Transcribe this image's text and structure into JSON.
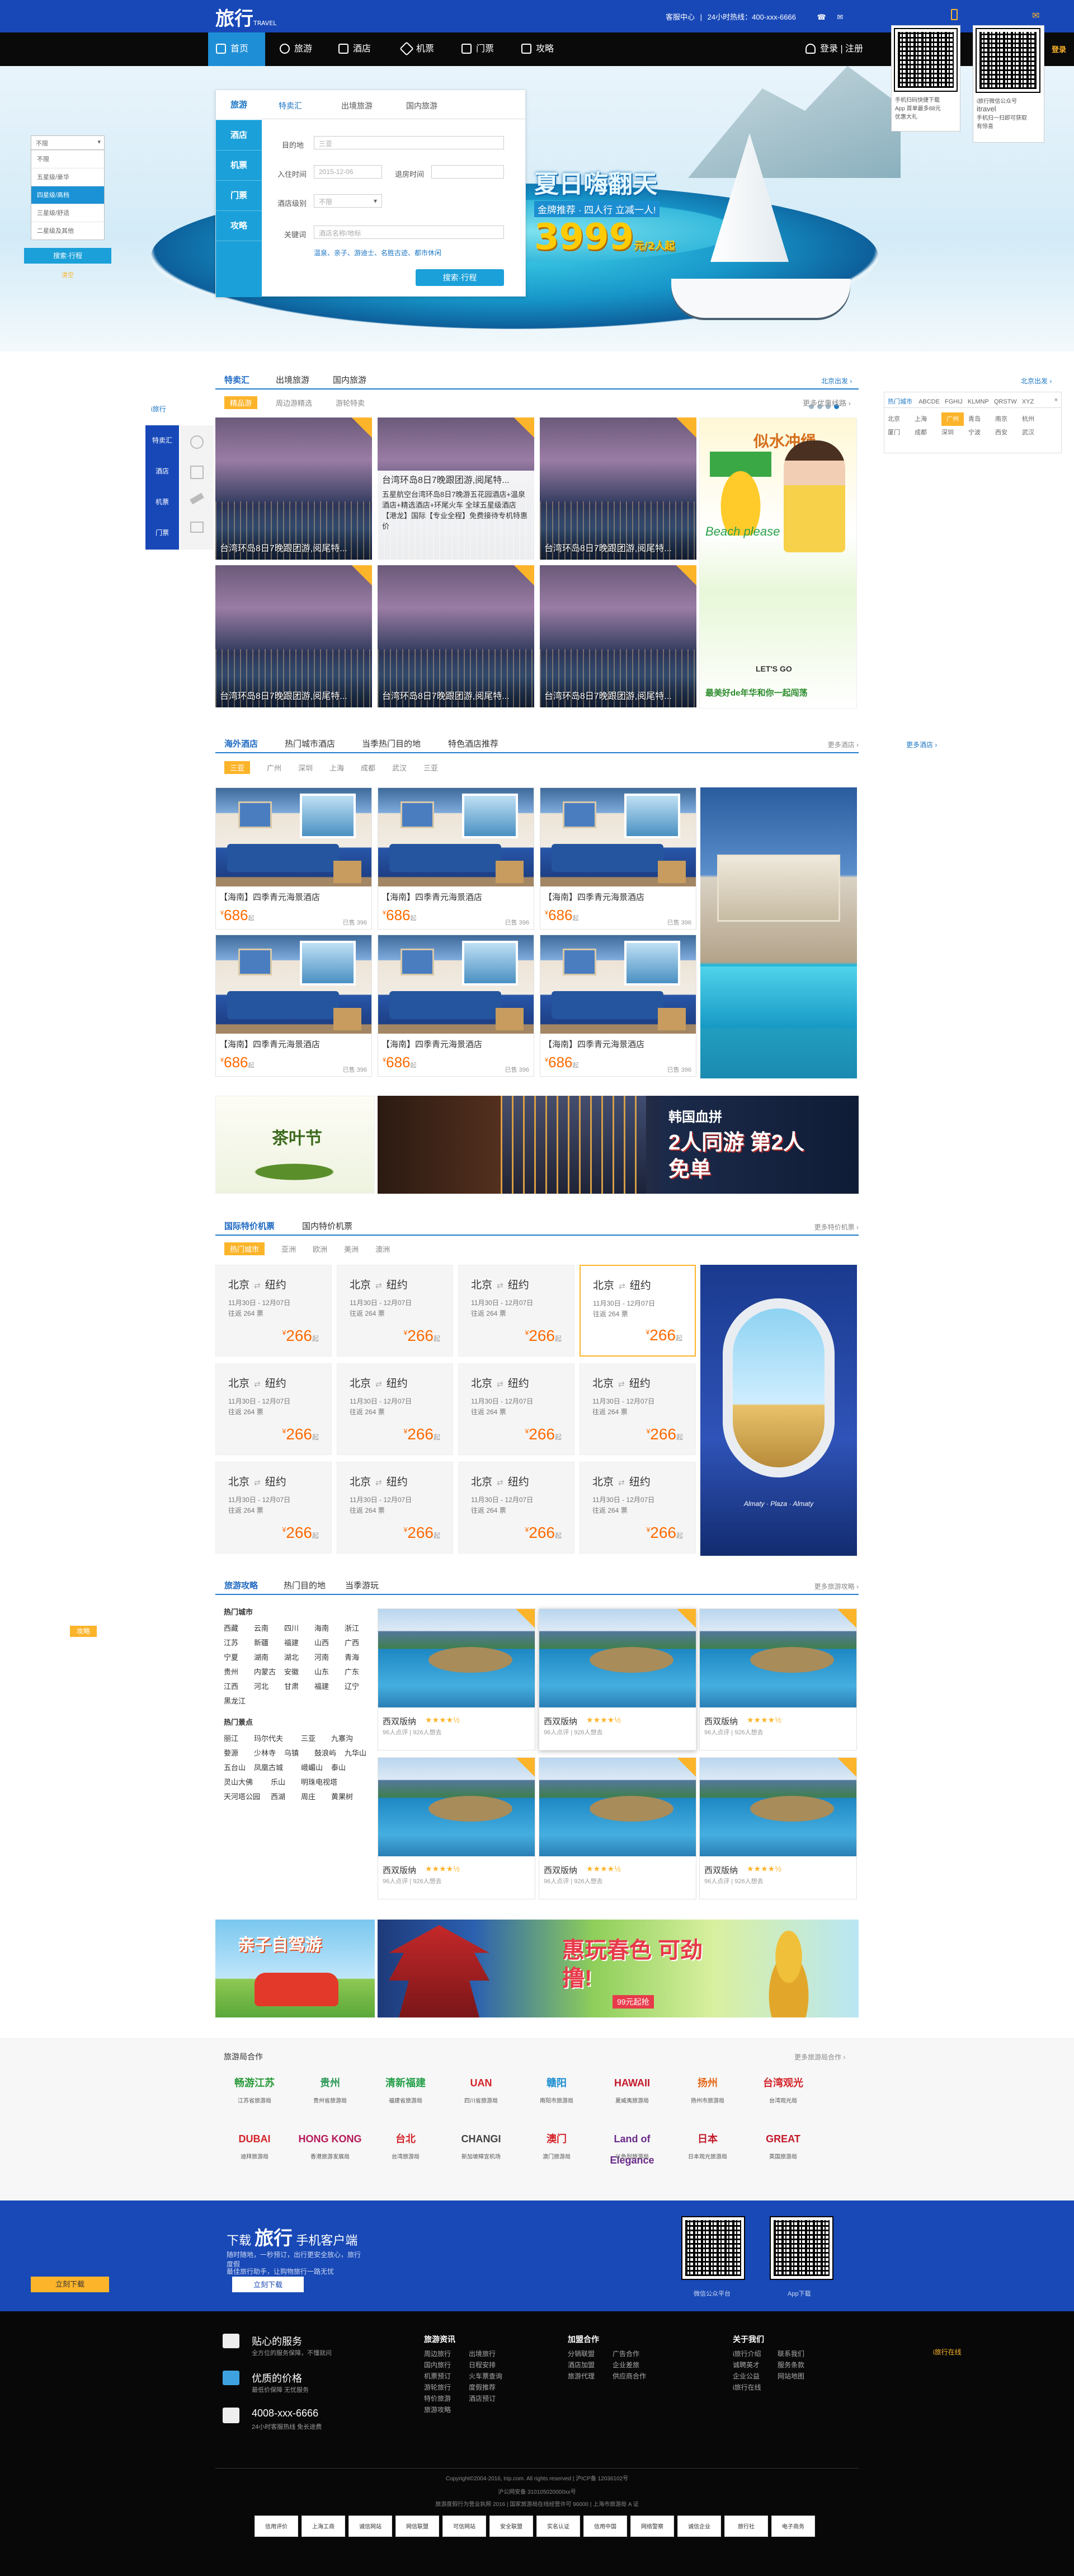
{
  "topbar": {
    "logo_text": "旅行",
    "logo_small": "TRAVEL",
    "links": [
      "客服中心",
      "|",
      "24小时热线：400-xxx-6666"
    ],
    "qr_left_text": [
      "手机扫码快捷下载",
      "App 首单最多88元",
      "优惠大礼"
    ],
    "qr_right_text": [
      "i旅行微信公众号",
      "itravel",
      "手机扫一扫即可获取",
      "有惊喜"
    ],
    "login_text": "登录"
  },
  "nav": {
    "items": [
      "首页",
      "旅游",
      "酒店",
      "机票",
      "门票",
      "攻略"
    ],
    "login_register": "登录 | 注册"
  },
  "hero": {
    "promo_title": "夏日嗨翻天",
    "promo_sub": "金牌推荐 · 四人行 立减一人!",
    "promo_price": "3999",
    "promo_price_unit": "元/2人起"
  },
  "left_filter": {
    "selected": "不限",
    "options": [
      "不限",
      "五星级/豪华",
      "四星级/高档",
      "三星级/舒适",
      "二星级及其他"
    ],
    "search_button": "搜索·行程",
    "reset": "清空"
  },
  "search": {
    "vertical_tabs": [
      "旅游",
      "酒店",
      "机票",
      "门票",
      "攻略"
    ],
    "horizontal_tabs": [
      "特卖汇",
      "出境旅游",
      "国内旅游"
    ],
    "labels": {
      "destination": "目的地",
      "checkin": "入住时间",
      "checkout": "退房时间",
      "level": "酒店级别",
      "keyword": "关键词"
    },
    "placeholders": {
      "destination": "三亚",
      "checkin": "2015-12-06",
      "level": "不限",
      "keyword": "酒店名称/地标"
    },
    "hot_words": "温泉、亲子、游迪士、名胜古迹、都市休闲",
    "button": "搜索·行程"
  },
  "sale": {
    "tabs": [
      "特卖汇",
      "出境旅游",
      "国内旅游"
    ],
    "subtabs": [
      "精品游",
      "周边游精选",
      "游轮特卖"
    ],
    "more": "更多优惠线路 ›",
    "side_menu": [
      "特卖汇",
      "酒店",
      "机票",
      "门票"
    ],
    "side_tag": "i旅行",
    "card_caption": "台湾环岛8日7晚跟团游,阅尾特...",
    "card_hover_title": "台湾环岛8日7晚跟团游,阅尾特...",
    "card_hover_desc": "五星航空台湾环岛8日7晚游五花园酒店+温泉酒店+精选酒店+环尾火车 全球五星级酒店【港龙】国际【专业全程】免费接待专机特惠价",
    "ad_title": "似水冲绳",
    "ad_sub": "Beach please",
    "ad_slogan": "最美好de年华和你一起闯荡",
    "ad_go": "LET'S GO"
  },
  "hot_cities": {
    "label": "北京出发 ›",
    "tabs": [
      "热门城市",
      "ABCDE",
      "FGHIJ",
      "KLMNP",
      "QRSTW",
      "XYZ"
    ],
    "cities": [
      "北京",
      "上海",
      "广州",
      "青岛",
      "南京",
      "杭州",
      "厦门",
      "成都",
      "深圳",
      "宁波",
      "西安",
      "武汉"
    ],
    "selected": "广州"
  },
  "hotel": {
    "tabs": [
      "海外酒店",
      "热门城市酒店",
      "当季热门目的地",
      "特色酒店推荐"
    ],
    "subtabs": [
      "三亚",
      "广州",
      "深圳",
      "上海",
      "成都",
      "武汉",
      "三亚"
    ],
    "more": "更多酒店 ›",
    "more2": "更多酒店 ›",
    "card_name": "【海南】四季青元海景酒店",
    "card_price": "686",
    "card_price_prefix": "¥",
    "card_price_suffix": "起",
    "card_reviews": "已售 396"
  },
  "banners": {
    "tea_title": "茶叶节",
    "korea_title": "韩国血拼",
    "korea_sub": "2人同游 第2人免单"
  },
  "flight": {
    "tabs": [
      "国际特价机票",
      "国内特价机票"
    ],
    "subtabs": [
      "热门城市",
      "亚洲",
      "欧洲",
      "美洲",
      "澳洲"
    ],
    "more": "更多特价机票 ›",
    "route_from": "北京",
    "route_arrow": "⇄",
    "route_to": "纽约",
    "date_line": "11月30日 - 12月07日",
    "tax_line": "往返 264 票",
    "price": "266",
    "price_prefix": "¥",
    "price_suffix": "起",
    "ad_caption": "Almaty · Plaza · Almaty"
  },
  "guide": {
    "tabs": [
      "旅游攻略",
      "热门目的地",
      "当季游玩"
    ],
    "more": "更多旅游攻略 ›",
    "hot_city_title": "热门城市",
    "hot_cities": [
      "西藏",
      "云南",
      "四川",
      "海南",
      "浙江",
      "江苏",
      "新疆",
      "福建",
      "山西",
      "广西",
      "宁夏",
      "湖南",
      "湖北",
      "河南",
      "青海",
      "贵州",
      "内蒙古",
      "安徽",
      "山东",
      "广东",
      "江西",
      "河北",
      "甘肃",
      "福建",
      "辽宁",
      "黑龙江"
    ],
    "hot_spot_title": "热门景点",
    "hot_spots": [
      "丽江",
      "玛尔代夫",
      "三亚",
      "九寨沟",
      "婺源",
      "少林寺",
      "乌镇",
      "鼓浪屿",
      "九华山",
      "五台山",
      "凤凰古城",
      "峨嵋山",
      "泰山",
      "灵山大佛",
      "乐山",
      "明珠电视塔",
      "天河塔公园",
      "西湖",
      "周庄",
      "黄果树"
    ],
    "left_tag": "攻略",
    "card_name": "西双版纳",
    "card_stars": "★★★★½",
    "card_reviews": "96人点评 | 926人想去"
  },
  "banners2": {
    "family_title": "亲子自驾游",
    "travel_title": "惠玩春色 可劲撸!",
    "travel_sub": "99元起抢"
  },
  "partners": {
    "title": "旅游局合作",
    "more": "更多旅游局合作 ›",
    "row1": [
      {
        "mark": "畅游江苏",
        "name": "江苏省旅游局",
        "color": "#2a9a3a"
      },
      {
        "mark": "贵州",
        "name": "贵州省旅游局",
        "color": "#2d9a58"
      },
      {
        "mark": "清新福建",
        "name": "福建省旅游局",
        "color": "#26a04a"
      },
      {
        "mark": "UAN",
        "name": "四川省旅游局",
        "color": "#d4242a"
      },
      {
        "mark": "赣阳",
        "name": "南阳市旅游局",
        "color": "#1b8ed1"
      },
      {
        "mark": "HAWAII",
        "name": "夏威夷旅游局",
        "color": "#c21a2b"
      },
      {
        "mark": "扬州",
        "name": "扬州市旅游局",
        "color": "#e46a1a"
      },
      {
        "mark": "台湾观光",
        "name": "台湾观光局",
        "color": "#d4242a"
      }
    ],
    "row2": [
      {
        "mark": "DUBAI",
        "name": "迪拜旅游局",
        "color": "#d4242a"
      },
      {
        "mark": "HONG KONG",
        "name": "香港旅游发展局",
        "color": "#b51a5a"
      },
      {
        "mark": "台北",
        "name": "台湾旅游局",
        "color": "#d4242a"
      },
      {
        "mark": "CHANGI",
        "name": "新加坡樟宜机场",
        "color": "#444444"
      },
      {
        "mark": "澳门",
        "name": "澳门旅游局",
        "color": "#d4242a"
      },
      {
        "mark": "Land of Elegance",
        "name": "以色列旅游局",
        "color": "#6a2a8a"
      },
      {
        "mark": "日本",
        "name": "日本观光旅游局",
        "color": "#c21a2b"
      },
      {
        "mark": "GREAT",
        "name": "英国旅游局",
        "color": "#c21a2b"
      }
    ]
  },
  "app": {
    "title_pre": "下载",
    "title_logo": "旅行",
    "title_post": "手机客户端",
    "desc": [
      "随时随地，一秒预订，出行更安全放心，旅行度假",
      "最佳旅行助手，让购物旅行一路无忧"
    ],
    "button": "立刻下载",
    "left_button": "立刻下载",
    "qr1_caption": "微信公众平台",
    "qr2_caption": "App下载"
  },
  "footer": {
    "service_title": "贴心的服务",
    "service_desc": "全方位的服务保障，不懂就问",
    "price_title": "优质的价格",
    "price_desc": "最低价保障 无忧服务",
    "phone": "4008-xxx-6666",
    "phone_desc": "24小时客服热线 免长途费",
    "cols": [
      {
        "title": "旅游资讯",
        "items": [
          "周边旅行",
          "出境旅行",
          "国内旅行",
          "日程安排",
          "机票预订",
          "火车票查询",
          "游轮旅行",
          "度假推荐",
          "特价旅游",
          "酒店预订",
          "旅游攻略"
        ]
      },
      {
        "title": "加盟合作",
        "items": [
          "分销联盟",
          "广告合作",
          "酒店加盟",
          "企业差旅",
          "旅游代理",
          "供应商合作"
        ]
      },
      {
        "title": "关于我们",
        "items": [
          "i旅行介绍",
          "联系我们",
          "诚聘英才",
          "服务条款",
          "企业公益",
          "网站地图",
          "i旅行在线"
        ]
      }
    ],
    "right_tag": "i旅行在线",
    "copyright": "Copyright©2004-2016, trip.com. All rights reserved | 沪ICP备 12036102号",
    "police": "沪公网安备 310105020000xx号",
    "license": "旅游度假行为营业执照 2016 | 国家旅游局在线经营许可 96000 | 上海市旅游局 A 证",
    "badges": [
      "信用评价",
      "上海工商",
      "诚信网站",
      "网信联盟",
      "可信网站",
      "安全联盟",
      "实名认证",
      "信用中国",
      "网络警察",
      "诚信企业",
      "旅行社",
      "电子商务"
    ]
  },
  "colors": {
    "brand": "#1848b8",
    "accent": "#1ba0d9",
    "orange": "#ff6a00",
    "gold": "#fcb42a"
  }
}
